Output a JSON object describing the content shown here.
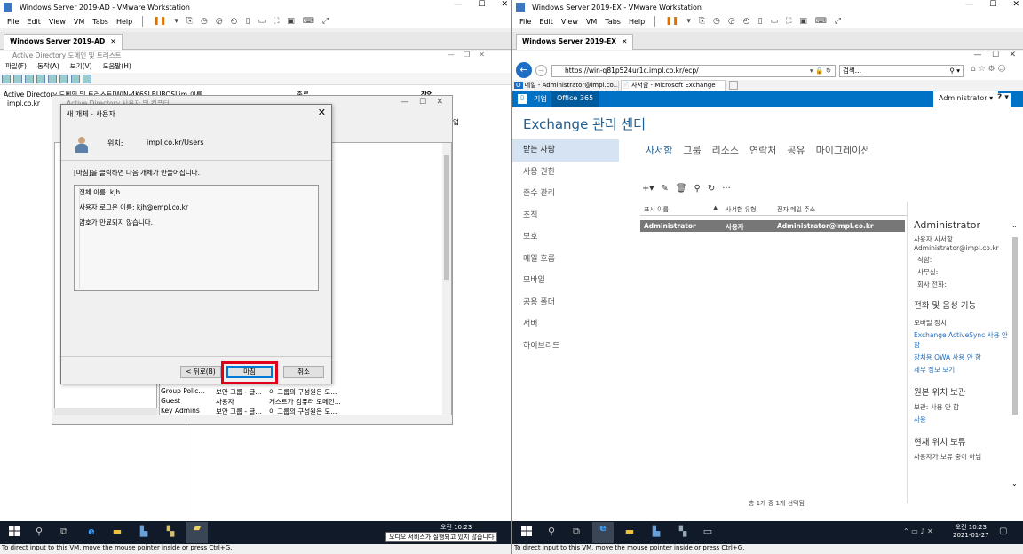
{
  "left": {
    "window_title": "Windows Server 2019-AD - VMware Workstation",
    "menu": [
      "File",
      "Edit",
      "View",
      "VM",
      "Tabs",
      "Help"
    ],
    "vm_tab": "Windows Server 2019-AD",
    "aduc": {
      "title": "Active Directory 도메인 및 트러스트",
      "menu": [
        "파일(F)",
        "동작(A)",
        "보기(V)",
        "도움말(H)"
      ],
      "tree_root": "Active Directory 도메인 및 트러스트[WIN-4K6SLBUBOSI.im",
      "tree_child": "impl.co.kr",
      "col_name": "이름",
      "col_type": "종류",
      "actions_header": "작업",
      "actions_item": "업",
      "bg_window_title": "Active Directory 사용자 및 컴퓨터"
    },
    "dialog": {
      "title": "새 개체 - 사용자",
      "location_label": "위치:",
      "location_value": "impl.co.kr/Users",
      "instruction": "[마침]을 클릭하면 다음 개체가 만들어집니다.",
      "lines": [
        "전체 이름: kjh",
        "사용자 로그온 이름: kjh@empl.co.kr",
        "암호가 만료되지 않습니다."
      ],
      "back": "< 뒤로(B)",
      "finish": "마침",
      "cancel": "취소"
    },
    "list_rows": [
      {
        "name": "Group Polic...",
        "type": "보안 그룹 - 글...",
        "desc": "이 그룹의 구성원은 도..."
      },
      {
        "name": "Guest",
        "type": "사용자",
        "desc": "게스트가 컴퓨터 도메인..."
      },
      {
        "name": "Key Admins",
        "type": "보안 그룹 - 글...",
        "desc": "이 그룹의 구성원은 도..."
      }
    ],
    "clock_time": "오전 10:23",
    "tooltip": "오디오 서비스가 실행되고 있지 않습니다",
    "status": "To direct input to this VM, move the mouse pointer inside or press Ctrl+G."
  },
  "right": {
    "window_title": "Windows Server 2019-EX - VMware Workstation",
    "menu": [
      "File",
      "Edit",
      "View",
      "VM",
      "Tabs",
      "Help"
    ],
    "vm_tab": "Windows Server 2019-EX",
    "url": "https://win-q81p524ur1c.impl.co.kr/ecp/",
    "search_placeholder": "검색...",
    "tab1": "메일 - Administrator@impl.co....",
    "tab2": "사서함 - Microsoft Exchange",
    "o365": {
      "enterprise": "기업",
      "office": "Office 365",
      "user": "Administrator ▾",
      "help": "? ▾"
    },
    "ecp_title": "Exchange 관리 센터",
    "nav": [
      "받는 사람",
      "사용 권한",
      "준수 관리",
      "조직",
      "보호",
      "메일 흐름",
      "모바일",
      "공용 폴더",
      "서버",
      "하이브리드"
    ],
    "subtabs": [
      "사서함",
      "그룹",
      "리소스",
      "연락처",
      "공유",
      "마이그레이션"
    ],
    "grid": {
      "col1": "표시 이름",
      "col2": "사서함 유형",
      "col3": "전자 메일 주소",
      "row": {
        "name": "Administrator",
        "type": "사용자",
        "email": "Administrator@impl.co.kr"
      }
    },
    "footer": "총 1개 중 1개 선택됨",
    "details": {
      "name": "Administrator",
      "type": "사용자 사서함",
      "email": "Administrator@impl.co.kr",
      "title": "직함:",
      "office": "사무실:",
      "phone": "회사 전화:",
      "section1": "전화 및 음성 기능",
      "mobile": "모바일 장치",
      "link1": "Exchange ActiveSync 사용 안 함",
      "link2": "장치용 OWA 사용 안 함",
      "link3": "세부 정보 보기",
      "section2": "원본 위치 보관",
      "archive": "보관: 사용 안 함",
      "link4": "사용",
      "section3": "현재 위치 보류",
      "hold": "사용자가 보류 중이 아님"
    },
    "clock_time": "오전 10:23",
    "clock_date": "2021-01-27",
    "status": "To direct input to this VM, move the mouse pointer inside or press Ctrl+G."
  }
}
